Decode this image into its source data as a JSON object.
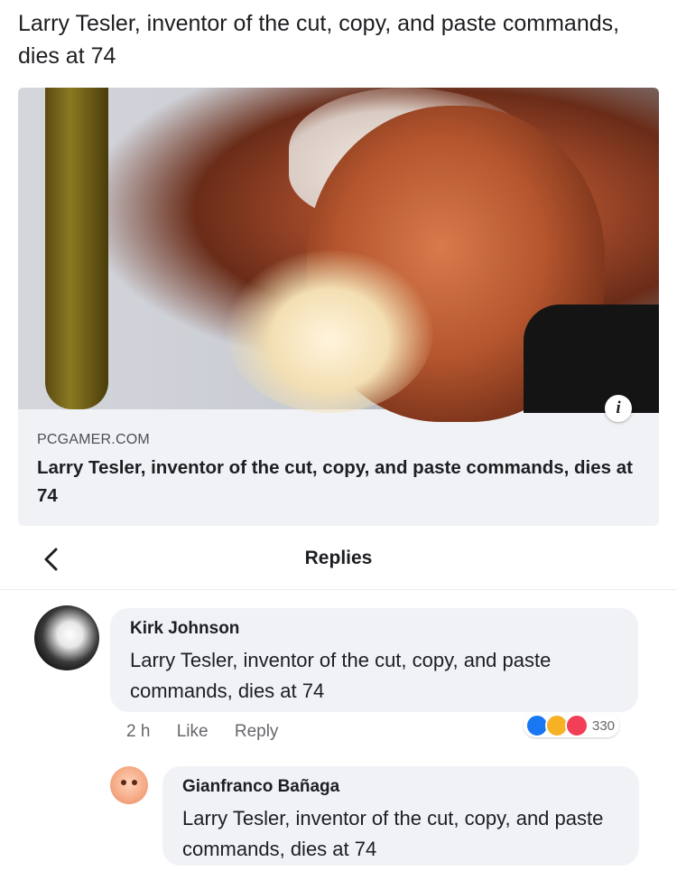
{
  "post": {
    "text": "Larry Tesler, inventor of the cut, copy, and paste commands, dies at 74"
  },
  "link_card": {
    "domain": "PCGAMER.COM",
    "title": "Larry Tesler, inventor of the cut, copy, and paste commands, dies at 74",
    "info_icon_glyph": "i",
    "image_icon": "article-photo"
  },
  "replies": {
    "title": "Replies",
    "back_glyph": "<"
  },
  "comments": [
    {
      "author": "Kirk Johnson",
      "text": "Larry Tesler, inventor of the cut, copy, and paste commands, dies at 74",
      "time": "2 h",
      "like_label": "Like",
      "reply_label": "Reply",
      "reaction_count": "330",
      "reaction_icons": [
        "like-reaction-icon",
        "haha-reaction-icon",
        "love-reaction-icon"
      ]
    },
    {
      "author": "Gianfranco Bañaga",
      "text": "Larry Tesler, inventor of the cut, copy, and paste commands, dies at 74"
    }
  ],
  "colors": {
    "bubble": "#f0f2f5",
    "like": "#1877f2",
    "haha": "#f7b125",
    "love": "#f33e58",
    "muted": "#65676b"
  }
}
